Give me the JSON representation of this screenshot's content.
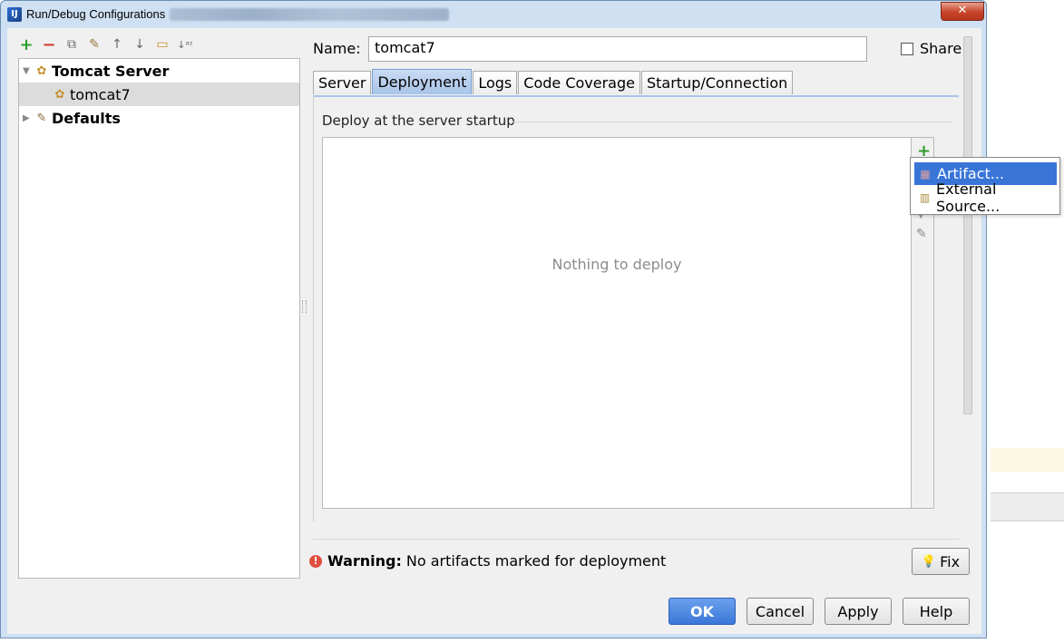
{
  "window": {
    "title": "Run/Debug Configurations",
    "app_icon": "intellij-icon",
    "close_glyph": "✕"
  },
  "toolbar": {
    "buttons": [
      {
        "name": "add-icon",
        "glyph": "+"
      },
      {
        "name": "remove-icon",
        "glyph": "−"
      },
      {
        "name": "copy-icon",
        "glyph": "⧉"
      },
      {
        "name": "wrench-icon",
        "glyph": "✎"
      },
      {
        "name": "arrow-up-icon",
        "glyph": "↑"
      },
      {
        "name": "arrow-down-icon",
        "glyph": "↓"
      },
      {
        "name": "folder-icon",
        "glyph": "▭"
      },
      {
        "name": "sort-icon",
        "glyph": "↓ᵃᶻ"
      }
    ]
  },
  "tree": {
    "items": [
      {
        "label": "Tomcat Server",
        "expanded": true,
        "bold": true
      },
      {
        "label": "tomcat7",
        "selected": true
      },
      {
        "label": "Defaults",
        "expanded": false,
        "bold": true
      }
    ]
  },
  "form": {
    "name_label": "Name:",
    "name_value": "tomcat7",
    "share_label": "Share"
  },
  "tabs": [
    "Server",
    "Deployment",
    "Logs",
    "Code Coverage",
    "Startup/Connection"
  ],
  "active_tab": "Deployment",
  "deployment": {
    "section_title": "Deploy at the server startup",
    "empty_text": "Nothing to deploy"
  },
  "popup": {
    "items": [
      {
        "label": "Artifact...",
        "icon": "artifact-icon",
        "highlighted": true
      },
      {
        "label": "External Source...",
        "icon": "external-source-icon",
        "highlighted": false
      }
    ]
  },
  "warning": {
    "prefix": "Warning:",
    "text": "No artifacts marked for deployment",
    "fix_label": "Fix"
  },
  "buttons": {
    "ok": "OK",
    "cancel": "Cancel",
    "apply": "Apply",
    "help": "Help"
  },
  "colors": {
    "accent": "#3875d7",
    "add_green": "#2f9c2f",
    "remove_red": "#d13b2f"
  }
}
